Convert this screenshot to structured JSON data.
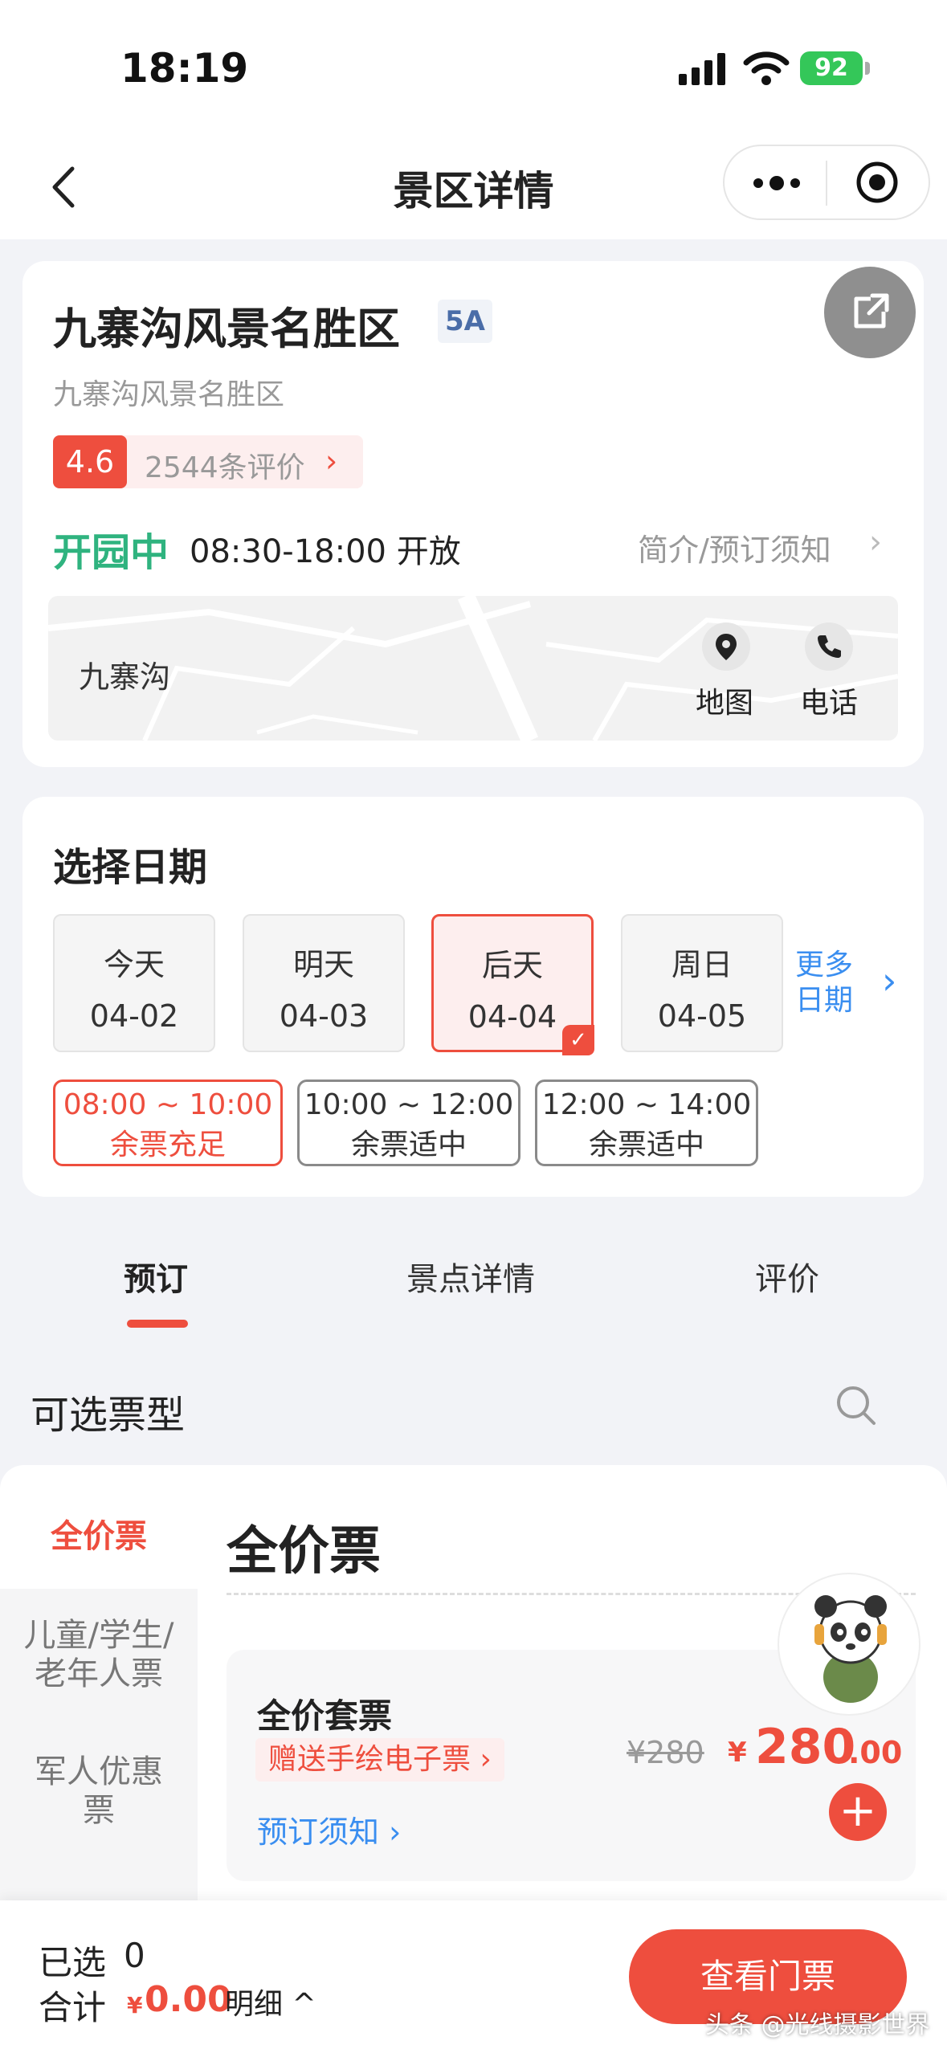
{
  "status_bar": {
    "time": "18:19",
    "battery": "92"
  },
  "nav": {
    "title": "景区详情"
  },
  "spot": {
    "name": "九寨沟风景名胜区",
    "level": "5A",
    "subtitle": "九寨沟风景名胜区",
    "score": "4.6",
    "reviews": "2544条评价",
    "open_status": "开园中",
    "hours": "08:30-18:00 开放",
    "intro_link": "简介/预订须知",
    "map_label": "九寨沟",
    "map_btn": "地图",
    "phone_btn": "电话"
  },
  "date_section": {
    "title": "选择日期",
    "dates": [
      {
        "label": "今天",
        "date": "04-02"
      },
      {
        "label": "明天",
        "date": "04-03"
      },
      {
        "label": "后天",
        "date": "04-04",
        "selected": true
      },
      {
        "label": "周日",
        "date": "04-05"
      }
    ],
    "more": "更多日期",
    "slots": [
      {
        "time": "08:00 ~ 10:00",
        "status": "余票充足",
        "selected": true
      },
      {
        "time": "10:00 ~ 12:00",
        "status": "余票适中"
      },
      {
        "time": "12:00 ~ 14:00",
        "status": "余票适中"
      }
    ]
  },
  "tabs": [
    "预订",
    "景点详情",
    "评价"
  ],
  "ticket_types_label": "可选票型",
  "sidebar": [
    "全价票",
    "儿童/学生/老年人票",
    "军人优惠票"
  ],
  "section_title": "全价票",
  "ticket": {
    "name": "全价套票",
    "gift": "赠送手绘电子票",
    "orig_price": "¥280",
    "price_symbol": "¥",
    "price_int": "280",
    "price_dec": ".00",
    "notice": "预订须知"
  },
  "bottom": {
    "selected_label": "已选",
    "selected_count": "0",
    "total_label": "合计",
    "total_symbol": "¥",
    "total_amount": "0.00",
    "detail": "明细",
    "view_button": "查看门票",
    "watermark": "头条 @光线摄影世界"
  },
  "colors": {
    "accent": "#ee4e3e",
    "open_green": "#2fb37f",
    "link_blue": "#3a8ef0"
  }
}
